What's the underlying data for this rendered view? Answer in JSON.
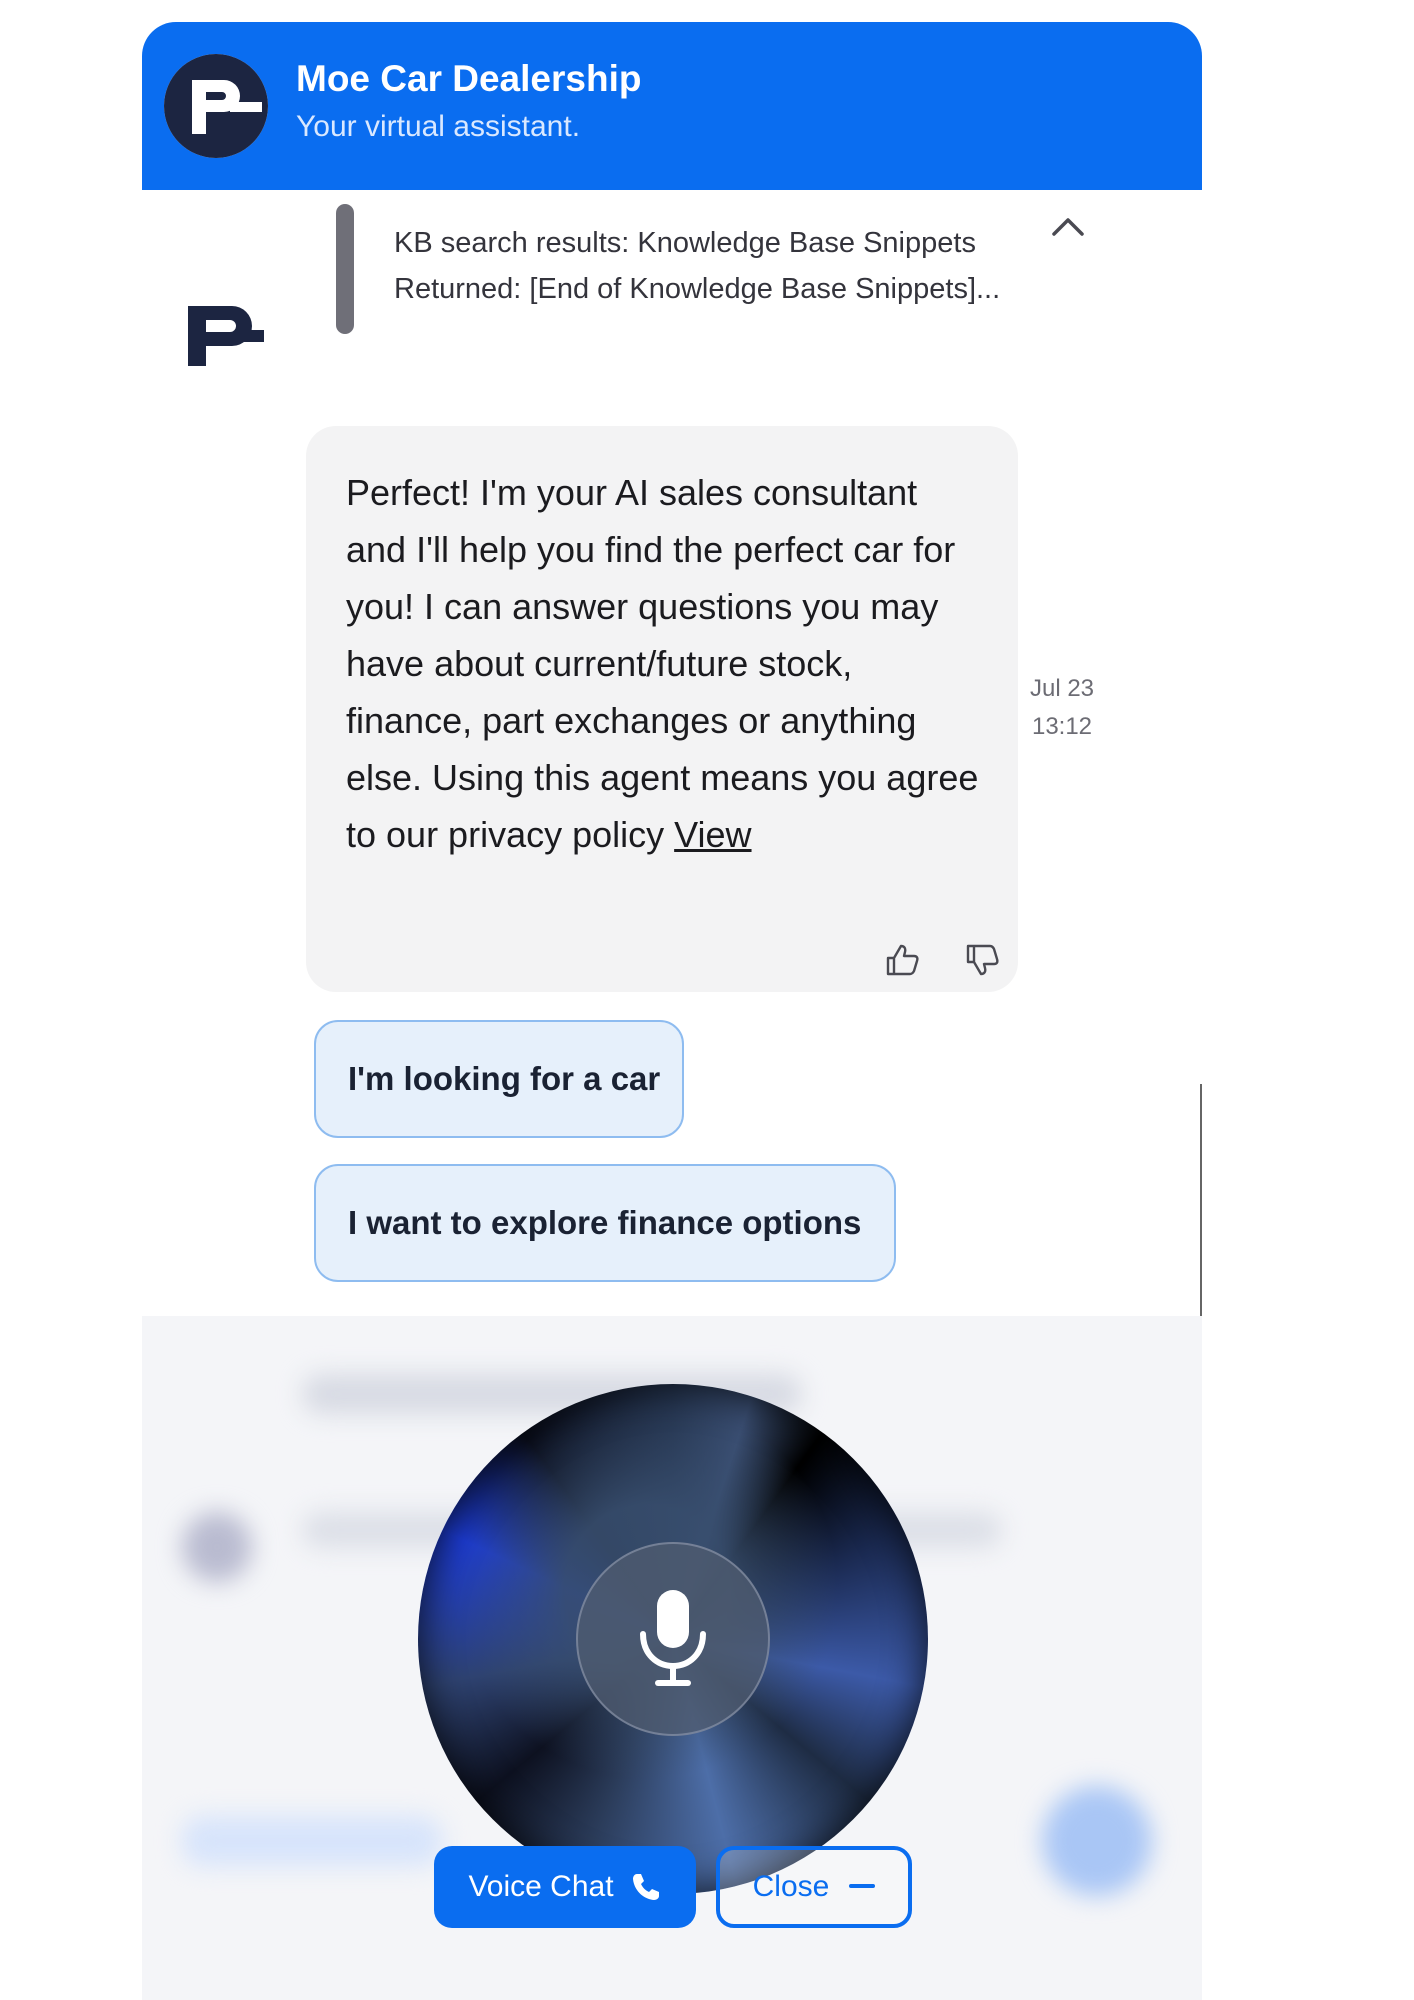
{
  "header": {
    "title": "Moe Car Dealership",
    "subtitle": "Your virtual assistant."
  },
  "kb": {
    "line1": "KB search results: Knowledge Base Snippets",
    "line2": "Returned: [End of Knowledge Base Snippets]..."
  },
  "message": {
    "text": "Perfect! I'm your AI sales consultant and I'll help you find the perfect car for you! I can answer questions you may have about current/future stock, finance, part exchanges or anything else. Using this agent means you agree to our privacy policy ",
    "link": "View",
    "date": "Jul 23",
    "time": "13:12"
  },
  "quick_replies": [
    "I'm looking for a car",
    "I want to explore finance options"
  ],
  "voice": {
    "voice_chat_label": "Voice Chat",
    "close_label": "Close"
  },
  "colors": {
    "brand": "#0a6df0",
    "logo_navy": "#1c2541",
    "bubble": "#f3f3f4",
    "chip": "#e6f0fb"
  },
  "icons": [
    "brand-logo-icon",
    "chevron-up-icon",
    "thumbs-up-icon",
    "thumbs-down-icon",
    "microphone-icon",
    "phone-icon",
    "minus-icon"
  ]
}
